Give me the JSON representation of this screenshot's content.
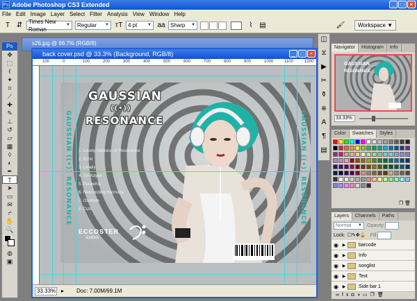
{
  "app": {
    "title": "Adobe Photoshop CS3 Extended",
    "badge": "Ps"
  },
  "menu": [
    "File",
    "Edit",
    "Image",
    "Layer",
    "Select",
    "Filter",
    "Analysis",
    "View",
    "Window",
    "Help"
  ],
  "options": {
    "font_family": "Times New Roman",
    "font_style": "Regular",
    "font_size": "4 pt",
    "antialias": "Sharp",
    "workspace": "Workspace"
  },
  "windows": {
    "back_title": "s26.jpg @ 66.7% (RGB/8)",
    "front_title": "back cover.psd @ 33.3% (Background, RGB/8)",
    "ruler_top_ticks": [
      "100",
      "0",
      "100",
      "200",
      "300",
      "400",
      "500",
      "600",
      "700",
      "800",
      "900",
      "1000",
      "1100",
      "1200"
    ],
    "status_zoom": "33.33%",
    "status_doc": "Doc: 7.00M/69.1M"
  },
  "artwork": {
    "title_line1": "GAUSSIAN",
    "title_symbol": "((•))",
    "title_line2": "RESONANCE",
    "spine_text": "GAUSSIAN ((•)) RESONANCE",
    "songs": [
      "1. Lovely Sickness In Resonance",
      "2. Echo",
      "3. Lonely",
      "4. Sin Kayes",
      "5. Paraxima",
      "6. Resounding Harmony",
      "7. Oscillate",
      "8. Cuts"
    ],
    "label_name": "ECCOSTER",
    "label_sub": "studios"
  },
  "panels": {
    "nav_tabs": [
      "Navigator",
      "Histogram",
      "Info"
    ],
    "nav_zoom": "33.33%",
    "color_tabs": [
      "Color",
      "Swatches",
      "Styles"
    ],
    "layers_tabs": [
      "Layers",
      "Channels",
      "Paths"
    ],
    "blend_mode": "Normal",
    "opacity_label": "Opacity:",
    "fill_label": "Fill:",
    "lock_label": "Lock:",
    "layers": [
      "barcode",
      "Info",
      "songlist",
      "Text",
      "Side bar 1"
    ]
  },
  "colors": {
    "xp_blue": "#245edb",
    "guide": "#47d5e2",
    "hair": "#1fb3a8"
  }
}
